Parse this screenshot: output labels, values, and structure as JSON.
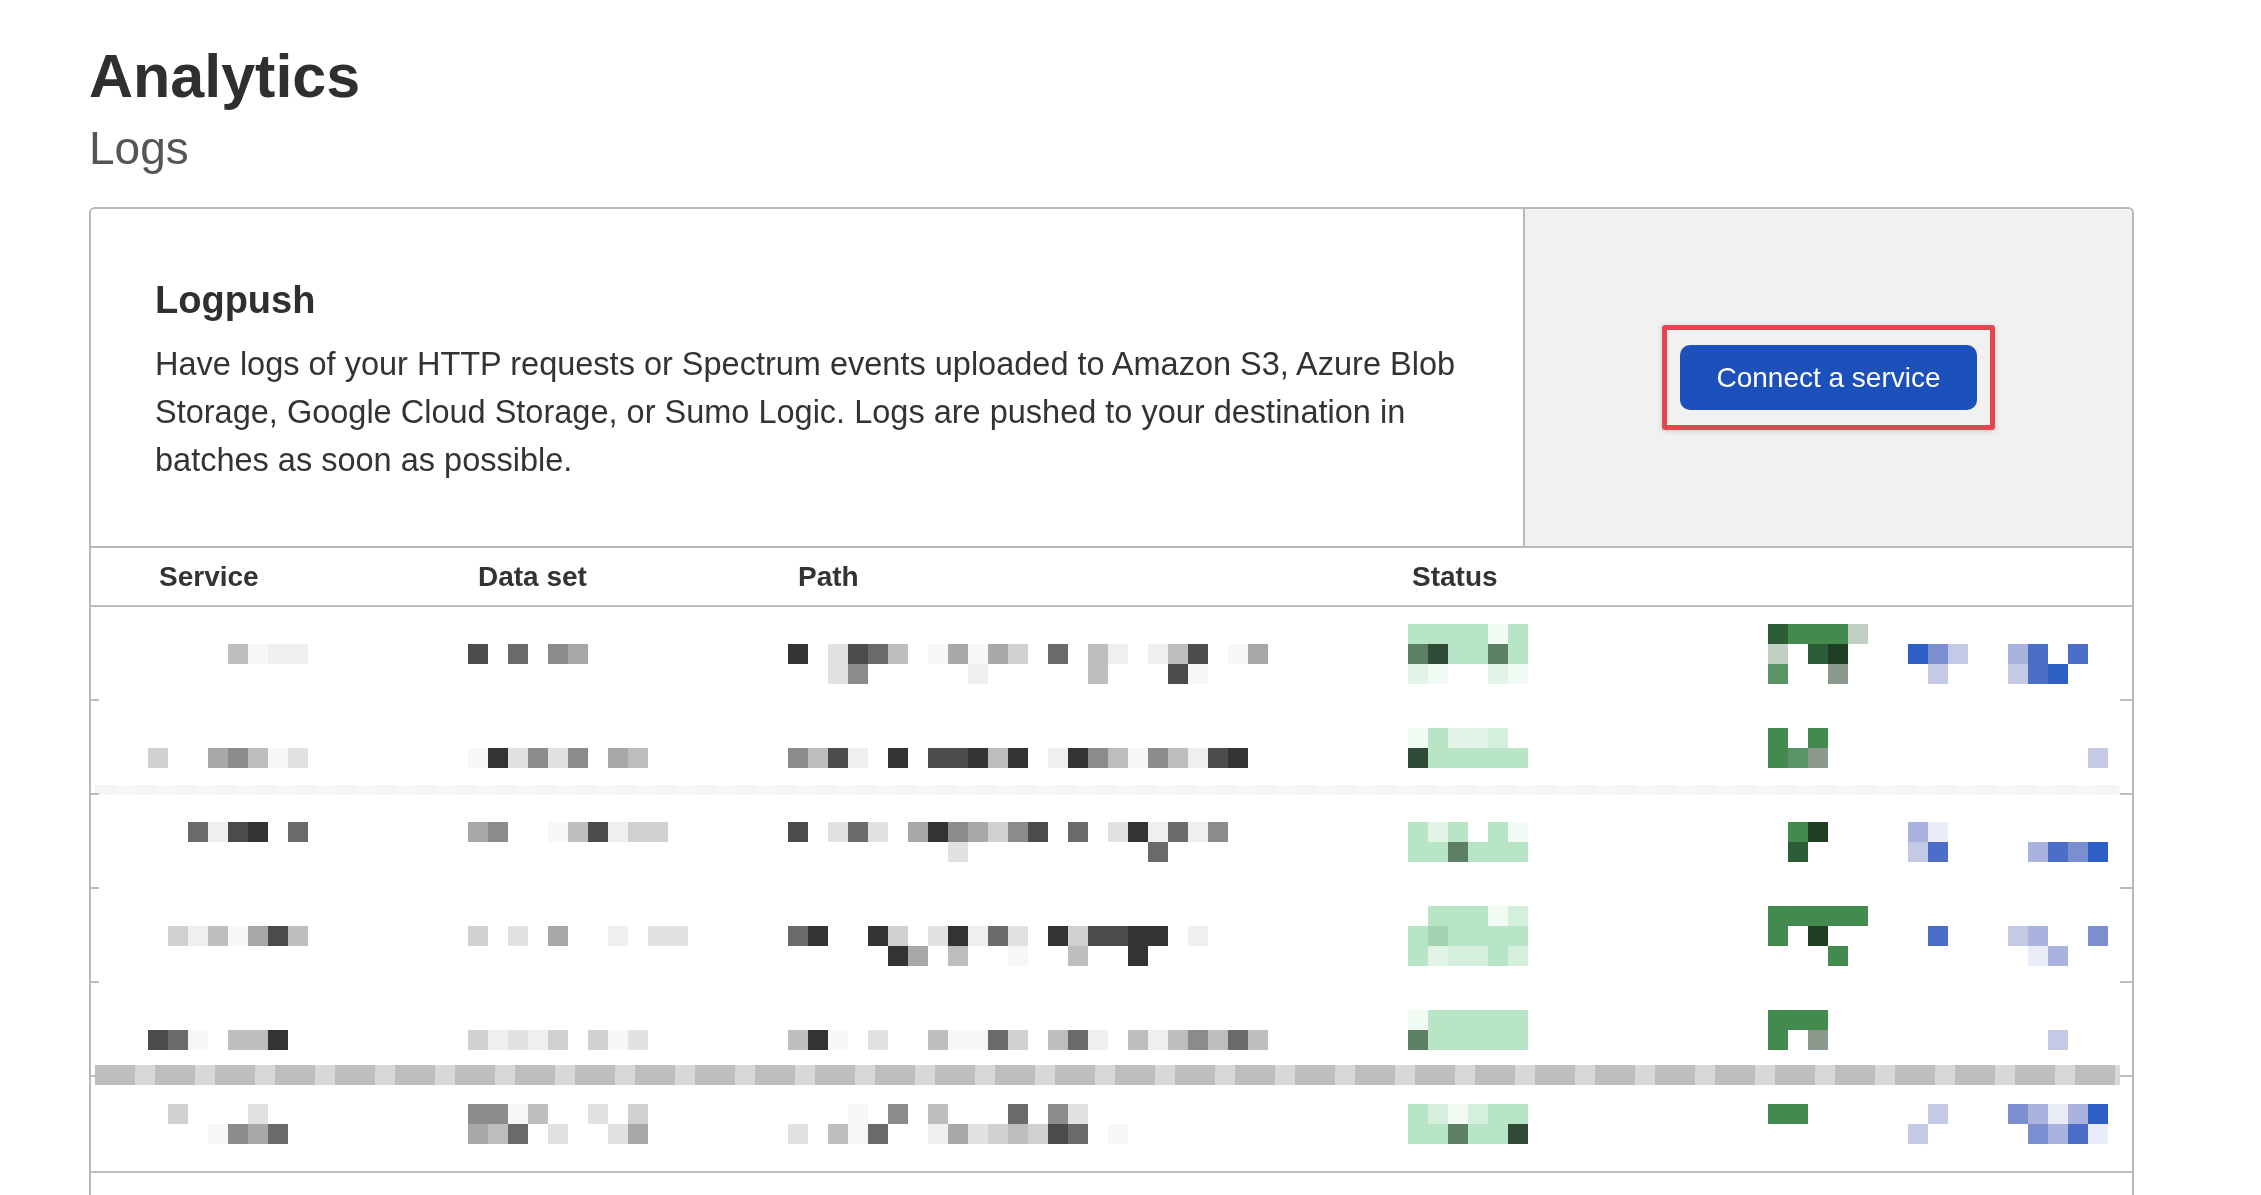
{
  "page": {
    "title": "Analytics",
    "subtitle": "Logs"
  },
  "logpush": {
    "title": "Logpush",
    "description": "Have logs of your HTTP requests or Spectrum events uploaded to Amazon S3, Azure Blob Storage, Google Cloud Storage, or Sumo Logic. Logs are pushed to your destination in batches as soon as possible.",
    "button": {
      "label": "Connect a service",
      "highlighted": true
    }
  },
  "table": {
    "columns": [
      "Service",
      "Data set",
      "Path",
      "Status"
    ],
    "rows": [
      {
        "kind": "pixelated"
      },
      {
        "kind": "pixelated"
      },
      {
        "kind": "pixelated"
      },
      {
        "kind": "pixelated"
      },
      {
        "kind": "pixelated"
      },
      {
        "kind": "pixelated"
      }
    ]
  }
}
